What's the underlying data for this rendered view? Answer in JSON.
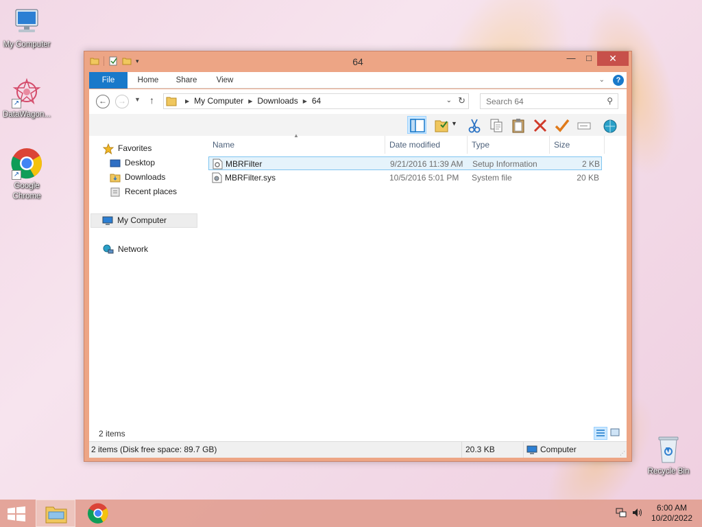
{
  "desktop": {
    "icons": [
      {
        "label": "My Computer"
      },
      {
        "label": "DataWagon..."
      },
      {
        "label": "Google Chrome"
      },
      {
        "label": "Recycle Bin"
      }
    ]
  },
  "window": {
    "title": "64",
    "controls": {
      "minimize": "—",
      "maximize": "□",
      "close": "✕"
    },
    "ribbon_tabs": [
      "File",
      "Home",
      "Share",
      "View"
    ],
    "address": {
      "crumbs": [
        "My Computer",
        "Downloads",
        "64"
      ]
    },
    "search": {
      "placeholder": "Search 64"
    },
    "nav_pane": {
      "favorites": "Favorites",
      "favorites_items": [
        "Desktop",
        "Downloads",
        "Recent places"
      ],
      "my_computer": "My Computer",
      "network": "Network"
    },
    "columns": {
      "name": "Name",
      "date": "Date modified",
      "type": "Type",
      "size": "Size"
    },
    "files": [
      {
        "name": "MBRFilter",
        "date": "9/21/2016 11:39 AM",
        "type": "Setup Information",
        "size": "2 KB"
      },
      {
        "name": "MBRFilter.sys",
        "date": "10/5/2016 5:01 PM",
        "type": "System file",
        "size": "20 KB"
      }
    ],
    "item_count": "2 items",
    "status": {
      "summary": "2 items (Disk free space: 89.7 GB)",
      "size": "20.3 KB",
      "location": "Computer"
    }
  },
  "taskbar": {
    "time": "6:00 AM",
    "date": "10/20/2022"
  },
  "colors": {
    "accent": "#1979ca",
    "window_frame": "#eda585",
    "close": "#c7504a",
    "selection": "#e5f3fb",
    "taskbar": "#e2a092"
  }
}
